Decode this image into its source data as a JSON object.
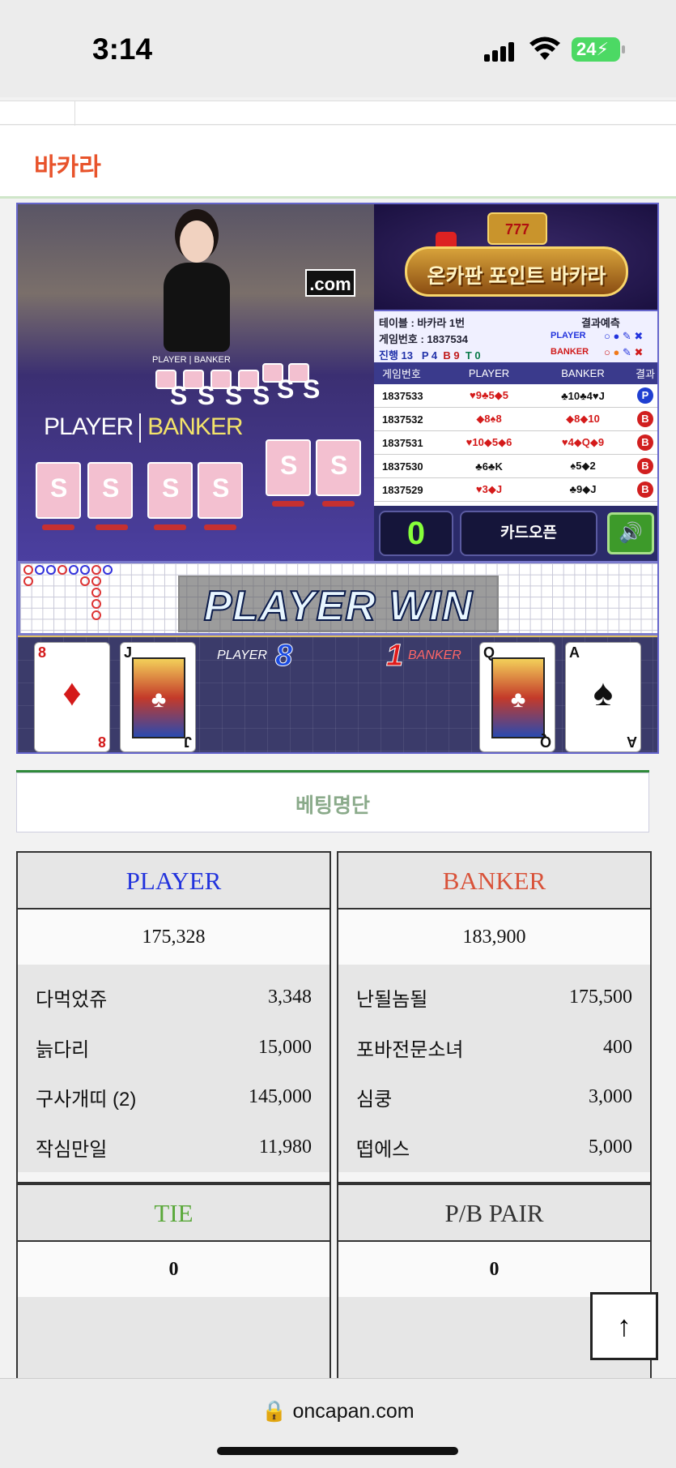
{
  "status_bar": {
    "time": "3:14",
    "battery": "24"
  },
  "header": {
    "title": "바카라"
  },
  "game": {
    "video": {
      "sign": ".com",
      "small_labels": "PLAYER | BANKER",
      "big_player": "PLAYER",
      "big_banker": "BANKER"
    },
    "promo": {
      "title": "온카판 포인트 바카라",
      "slots": "777"
    },
    "info": {
      "table": "테이블 : 바카라 1번",
      "game_no": "게임번호 : 1837534",
      "progress_label": "진행 13",
      "p": "P 4",
      "b": "B 9",
      "t": "T 0",
      "predict_title": "결과예측",
      "player_label": "PLAYER",
      "banker_label": "BANKER"
    },
    "history": {
      "headers": [
        "게임번호",
        "PLAYER",
        "BANKER",
        "결과"
      ],
      "rows": [
        {
          "no": "1837533",
          "player": "♥9♣5◆5",
          "banker": "♣10♣4♥J",
          "result": "P"
        },
        {
          "no": "1837532",
          "player": "◆8♠8",
          "banker": "◆8◆10",
          "result": "B"
        },
        {
          "no": "1837531",
          "player": "♥10◆5◆6",
          "banker": "♥4◆Q◆9",
          "result": "B"
        },
        {
          "no": "1837530",
          "player": "♣6♣K",
          "banker": "♠5◆2",
          "result": "B"
        },
        {
          "no": "1837529",
          "player": "♥3◆J",
          "banker": "♣9◆J",
          "result": "B"
        }
      ]
    },
    "timer": "0",
    "open_button": "카드오픈",
    "speaker_icon": "speaker-icon",
    "win_banner": "PLAYER WIN",
    "player_hand": {
      "label": "PLAYER",
      "score": "8",
      "cards": [
        {
          "rank": "8",
          "suit": "♦",
          "color": "red"
        },
        {
          "rank": "J",
          "suit": "♣",
          "color": "black"
        }
      ]
    },
    "banker_hand": {
      "label": "BANKER",
      "score": "1",
      "cards": [
        {
          "rank": "Q",
          "suit": "♣",
          "color": "black"
        },
        {
          "rank": "A",
          "suit": "♠",
          "color": "black"
        }
      ]
    }
  },
  "bet_list": {
    "title": "베팅명단"
  },
  "panels": {
    "player": {
      "title": "PLAYER",
      "color": "#2233dd",
      "total": "175,328",
      "bets": [
        {
          "name": "다먹었쥬",
          "amount": "3,348"
        },
        {
          "name": "늙다리",
          "amount": "15,000"
        },
        {
          "name": "구사개띠 (2)",
          "amount": "145,000"
        },
        {
          "name": "작심만일",
          "amount": "11,980"
        }
      ]
    },
    "banker": {
      "title": "BANKER",
      "color": "#d9533a",
      "total": "183,900",
      "bets": [
        {
          "name": "난될놈될",
          "amount": "175,500"
        },
        {
          "name": "포바전문소녀",
          "amount": "400"
        },
        {
          "name": "심쿵",
          "amount": "3,000"
        },
        {
          "name": "떱에스",
          "amount": "5,000"
        }
      ]
    },
    "tie": {
      "title": "TIE",
      "color": "#5aa83a",
      "total": "0"
    },
    "pair": {
      "title": "P/B PAIR",
      "color": "#333333",
      "total": "0"
    }
  },
  "browser": {
    "url": "oncapan.com"
  },
  "scroll_top_icon": "arrow-up-icon"
}
